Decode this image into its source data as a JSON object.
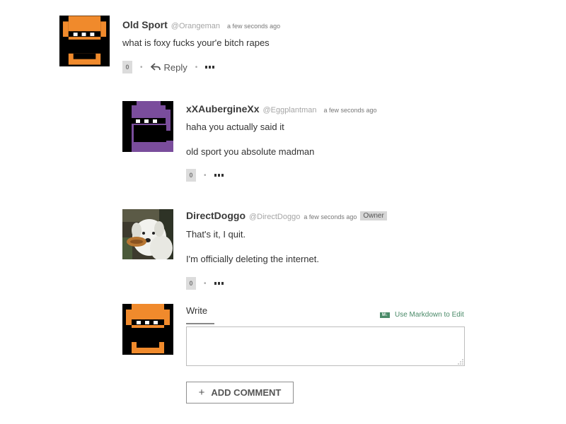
{
  "comments": [
    {
      "author": "Old Sport",
      "handle": "@Orangeman",
      "timestamp": "a few seconds ago",
      "lines": [
        "what is foxy fucks your'e bitch rapes"
      ],
      "votes": "0",
      "reply_label": "Reply",
      "avatar_icon": "orange-pixel-character"
    },
    {
      "author": "xXAubergineXx",
      "handle": "@Eggplantman",
      "timestamp": "a few seconds ago",
      "lines": [
        "haha you actually said it",
        "old sport you absolute madman"
      ],
      "votes": "0",
      "avatar_icon": "purple-pixel-character"
    },
    {
      "author": "DirectDoggo",
      "handle": "@DirectDoggo",
      "timestamp": "a few seconds ago",
      "badge": "Owner",
      "lines": [
        "That's it, I quit.",
        "I'm officially deleting the internet."
      ],
      "votes": "0",
      "avatar_icon": "dog-photo"
    }
  ],
  "composer": {
    "write_tab": "Write",
    "markdown_hint": "Use Markdown to Edit",
    "markdown_icon": "markdown-icon",
    "textarea_value": "",
    "submit_label": "ADD COMMENT",
    "avatar_icon": "orange-pixel-character"
  },
  "colors": {
    "orange": "#f08a2c",
    "purple": "#7a4d9c",
    "accent_green": "#4a8a68"
  }
}
